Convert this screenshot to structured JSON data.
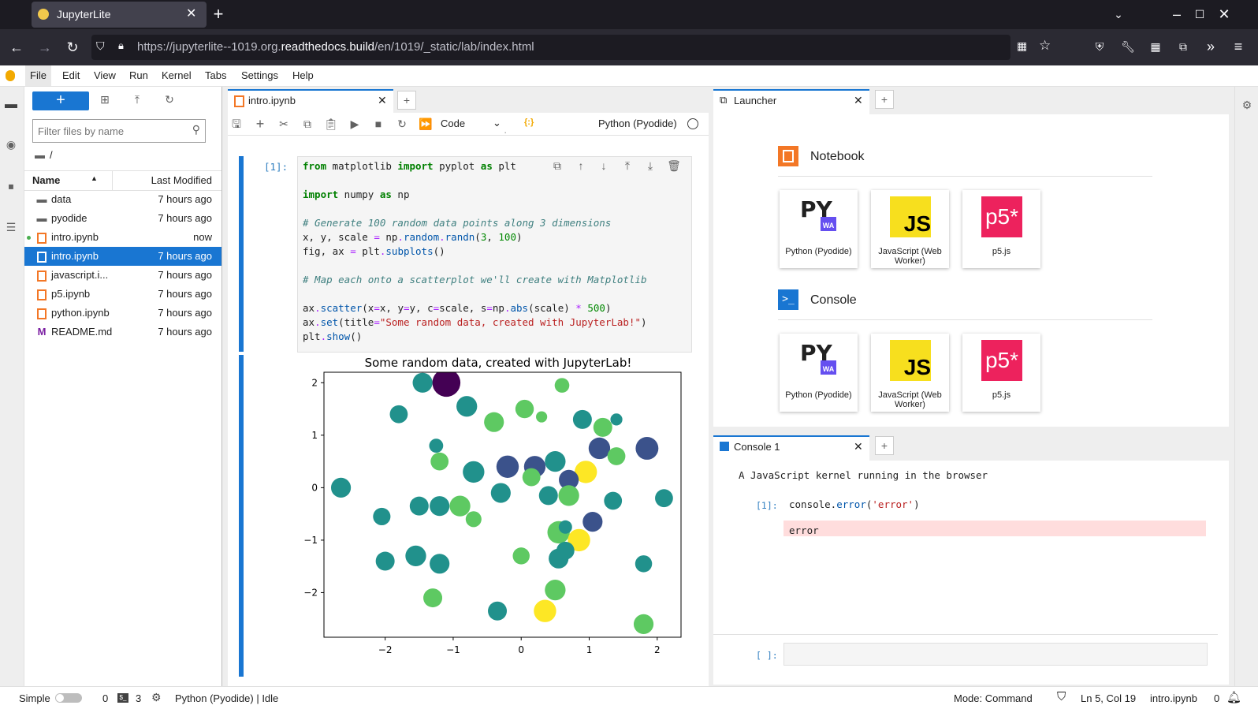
{
  "browser": {
    "tab_title": "JupyterLite",
    "url_prefix": "https://jupyterlite--1019.org.",
    "url_domain": "readthedocs.build",
    "url_path": "/en/1019/_static/lab/index.html"
  },
  "menu": [
    "File",
    "Edit",
    "View",
    "Run",
    "Kernel",
    "Tabs",
    "Settings",
    "Help"
  ],
  "filebrowser": {
    "filter_placeholder": "Filter files by name",
    "path": "/",
    "col_name": "Name",
    "col_modified": "Last Modified",
    "rows": [
      {
        "name": "data",
        "time": "7 hours ago",
        "icon": "folder-icon"
      },
      {
        "name": "pyodide",
        "time": "7 hours ago",
        "icon": "folder-icon"
      },
      {
        "name": "intro.ipynb",
        "time": "now",
        "icon": "notebook-icon"
      },
      {
        "name": "intro.ipynb",
        "time": "7 hours ago",
        "icon": "notebook-icon"
      },
      {
        "name": "javascript.i...",
        "time": "7 hours ago",
        "icon": "notebook-icon"
      },
      {
        "name": "p5.ipynb",
        "time": "7 hours ago",
        "icon": "notebook-icon"
      },
      {
        "name": "python.ipynb",
        "time": "7 hours ago",
        "icon": "notebook-icon"
      },
      {
        "name": "README.md",
        "time": "7 hours ago",
        "icon": "markdown-icon"
      }
    ]
  },
  "notebook": {
    "tab_title": "intro.ipynb",
    "cell_type": "Code",
    "kernel_name": "Python (Pyodide)",
    "prompt": "[1]:"
  },
  "chart_data": {
    "type": "scatter",
    "title": "Some random data, created with JupyterLab!",
    "xlim": [
      -2.9,
      2.35
    ],
    "ylim": [
      -2.85,
      2.2
    ],
    "xticks": [
      -2,
      -1,
      0,
      1,
      2
    ],
    "yticks": [
      2,
      1,
      0,
      -1,
      -2
    ],
    "xtick_labels": [
      "−2",
      "−1",
      "0",
      "1",
      "2"
    ],
    "ytick_labels": [
      "2",
      "1",
      "0",
      "−1",
      "−2"
    ],
    "colormap": [
      "#440154",
      "#3b528b",
      "#21918c",
      "#5ec962",
      "#fde725"
    ],
    "points": [
      {
        "x": -1.1,
        "y": 2.0,
        "s": 2.2,
        "c": 0.0
      },
      {
        "x": -1.45,
        "y": 2.0,
        "s": 1.1,
        "c": 0.45
      },
      {
        "x": -0.8,
        "y": 1.55,
        "s": 1.2,
        "c": 0.45
      },
      {
        "x": -1.8,
        "y": 1.4,
        "s": 0.9,
        "c": 0.5
      },
      {
        "x": 0.6,
        "y": 1.95,
        "s": 0.6,
        "c": 0.7
      },
      {
        "x": 0.05,
        "y": 1.5,
        "s": 0.95,
        "c": 0.75
      },
      {
        "x": -0.4,
        "y": 1.25,
        "s": 1.1,
        "c": 0.75
      },
      {
        "x": 0.9,
        "y": 1.3,
        "s": 1.0,
        "c": 0.45
      },
      {
        "x": 1.2,
        "y": 1.15,
        "s": 1.0,
        "c": 0.8
      },
      {
        "x": 1.85,
        "y": 0.75,
        "s": 1.45,
        "c": 0.3
      },
      {
        "x": 1.15,
        "y": 0.75,
        "s": 1.3,
        "c": 0.3
      },
      {
        "x": 0.95,
        "y": 0.3,
        "s": 1.4,
        "c": 1.0
      },
      {
        "x": 1.4,
        "y": 0.6,
        "s": 0.9,
        "c": 0.75
      },
      {
        "x": -2.65,
        "y": 0.0,
        "s": 1.1,
        "c": 0.55
      },
      {
        "x": -1.2,
        "y": 0.5,
        "s": 0.9,
        "c": 0.7
      },
      {
        "x": -0.7,
        "y": 0.3,
        "s": 1.3,
        "c": 0.4
      },
      {
        "x": -0.2,
        "y": 0.4,
        "s": 1.4,
        "c": 0.35
      },
      {
        "x": 0.2,
        "y": 0.4,
        "s": 1.3,
        "c": 0.35
      },
      {
        "x": 0.5,
        "y": 0.5,
        "s": 1.2,
        "c": 0.6
      },
      {
        "x": 0.7,
        "y": 0.15,
        "s": 1.1,
        "c": 0.3
      },
      {
        "x": -1.5,
        "y": -0.35,
        "s": 1.0,
        "c": 0.5
      },
      {
        "x": -1.2,
        "y": -0.35,
        "s": 1.1,
        "c": 0.45
      },
      {
        "x": -0.9,
        "y": -0.35,
        "s": 1.2,
        "c": 0.85
      },
      {
        "x": -0.3,
        "y": -0.1,
        "s": 1.1,
        "c": 0.5
      },
      {
        "x": 0.15,
        "y": 0.2,
        "s": 0.9,
        "c": 0.8
      },
      {
        "x": 0.4,
        "y": -0.15,
        "s": 1.0,
        "c": 0.5
      },
      {
        "x": 0.7,
        "y": -0.15,
        "s": 1.2,
        "c": 0.85
      },
      {
        "x": 1.35,
        "y": -0.25,
        "s": 0.9,
        "c": 0.5
      },
      {
        "x": 2.1,
        "y": -0.2,
        "s": 0.9,
        "c": 0.5
      },
      {
        "x": -2.05,
        "y": -0.55,
        "s": 0.85,
        "c": 0.55
      },
      {
        "x": -0.7,
        "y": -0.6,
        "s": 0.7,
        "c": 0.7
      },
      {
        "x": 0.55,
        "y": -0.85,
        "s": 1.4,
        "c": 0.8
      },
      {
        "x": 0.85,
        "y": -1.0,
        "s": 1.4,
        "c": 1.0
      },
      {
        "x": 1.05,
        "y": -0.65,
        "s": 1.1,
        "c": 0.35
      },
      {
        "x": -2.0,
        "y": -1.4,
        "s": 1.0,
        "c": 0.45
      },
      {
        "x": -1.55,
        "y": -1.3,
        "s": 1.2,
        "c": 0.4
      },
      {
        "x": -1.2,
        "y": -1.45,
        "s": 1.1,
        "c": 0.45
      },
      {
        "x": 0.0,
        "y": -1.3,
        "s": 0.8,
        "c": 0.7
      },
      {
        "x": 0.55,
        "y": -1.35,
        "s": 1.1,
        "c": 0.45
      },
      {
        "x": 0.65,
        "y": -1.2,
        "s": 0.9,
        "c": 0.6
      },
      {
        "x": 1.8,
        "y": -1.45,
        "s": 0.8,
        "c": 0.6
      },
      {
        "x": -1.3,
        "y": -2.1,
        "s": 1.0,
        "c": 0.8
      },
      {
        "x": -0.35,
        "y": -2.35,
        "s": 1.0,
        "c": 0.45
      },
      {
        "x": 0.5,
        "y": -1.95,
        "s": 1.2,
        "c": 0.85
      },
      {
        "x": 0.35,
        "y": -2.35,
        "s": 1.4,
        "c": 1.0
      },
      {
        "x": 1.8,
        "y": -2.6,
        "s": 1.1,
        "c": 0.8
      },
      {
        "x": 0.65,
        "y": -0.75,
        "s": 0.5,
        "c": 0.55
      },
      {
        "x": -1.25,
        "y": 0.8,
        "s": 0.55,
        "c": 0.55
      },
      {
        "x": 1.4,
        "y": 1.3,
        "s": 0.4,
        "c": 0.6
      },
      {
        "x": 0.3,
        "y": 1.35,
        "s": 0.35,
        "c": 0.65
      }
    ]
  },
  "launcher": {
    "tab_title": "Launcher",
    "notebook_section": "Notebook",
    "console_section": "Console",
    "cards": [
      {
        "label": "Python (Pyodide)",
        "logo": "PY",
        "sub": "WA"
      },
      {
        "label": "JavaScript (Web Worker)",
        "logo": "JS"
      },
      {
        "label": "p5.js",
        "logo": "p5*"
      }
    ]
  },
  "console": {
    "tab_title": "Console 1",
    "banner": "A JavaScript kernel running in the browser",
    "prompt_done": "[1]:",
    "input_code_a": "console.",
    "input_code_b": "error",
    "input_code_c": "(",
    "input_code_d": "'error'",
    "input_code_e": ")",
    "error_output": "error",
    "prompt_empty": "[ ]:"
  },
  "status": {
    "mode_label": "Simple",
    "count_a": "0",
    "count_b": "3",
    "kernel_status": "Python (Pyodide) | Idle",
    "mode": "Mode: Command",
    "cursor": "Ln 5, Col 19",
    "filename": "intro.ipynb",
    "count_c": "0"
  },
  "colors": {
    "accent": "#1976d2",
    "notebook_orange": "#f37726",
    "js_yellow": "#f7df1e",
    "p5_pink": "#ed225d",
    "error_bg": "#fdd"
  }
}
